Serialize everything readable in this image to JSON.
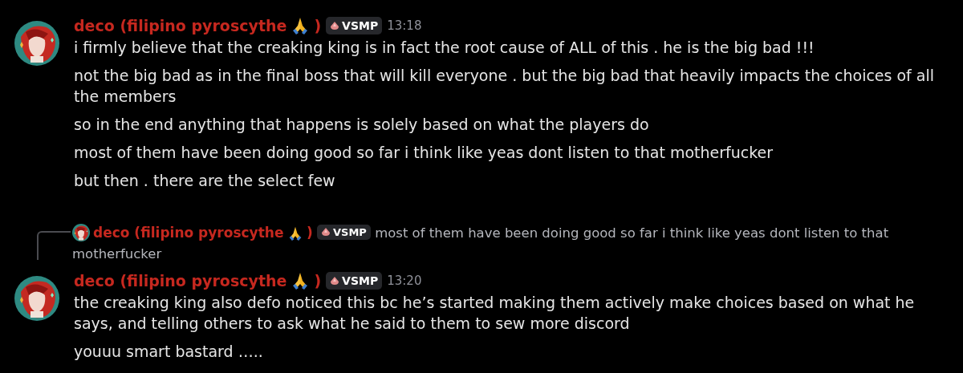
{
  "messages": [
    {
      "kind": "message",
      "author": "deco (filipino pyroscythe",
      "author_end": ")",
      "tag": "VSMP",
      "time": "13:18",
      "lines": [
        "i firmly believe that the creaking king is in fact the root cause of ALL of this . he is the big bad !!!",
        "not the big bad as in the final boss that will kill everyone . but the big bad that heavily impacts the choices of all the members",
        "so in the end anything that happens is solely based on what the players do",
        "most of them have been doing good so far i think like yeas dont listen to that motherfucker",
        "but then . there are the select few"
      ]
    },
    {
      "kind": "reply",
      "author": "deco (filipino pyroscythe",
      "author_end": ")",
      "tag": "VSMP",
      "quote_lines": [
        "most of them have been doing good so far i think like yeas dont listen to that",
        "motherfucker"
      ]
    },
    {
      "kind": "message",
      "author": "deco (filipino pyroscythe",
      "author_end": ")",
      "tag": "VSMP",
      "time": "13:20",
      "lines": [
        "the creaking king also defo noticed this bc he’s started making them actively make choices based on what he says, and telling others to ask what he said to them to sew more discord",
        "youuu smart bastard ….."
      ]
    }
  ]
}
